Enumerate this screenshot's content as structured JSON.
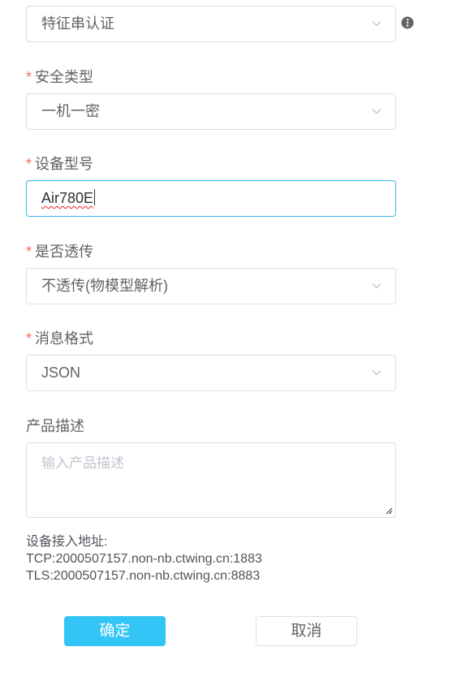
{
  "auth_mode": {
    "value": "特征串认证",
    "info_icon": "info-icon"
  },
  "security_type": {
    "label": "安全类型",
    "value": "一机一密"
  },
  "device_model": {
    "label": "设备型号",
    "value": "Air780E"
  },
  "passthrough": {
    "label": "是否透传",
    "value": "不透传(物模型解析)"
  },
  "message_format": {
    "label": "消息格式",
    "value": "JSON"
  },
  "description": {
    "label": "产品描述",
    "placeholder": "输入产品描述"
  },
  "access_address": {
    "title": "设备接入地址:",
    "tcp": "TCP:2000507157.non-nb.ctwing.cn:1883",
    "tls": "TLS:2000507157.non-nb.ctwing.cn:8883"
  },
  "buttons": {
    "confirm": "确定",
    "cancel": "取消"
  },
  "colors": {
    "primary": "#33c5f6",
    "required": "#f56c6c",
    "focus_border": "#35b7f0"
  }
}
